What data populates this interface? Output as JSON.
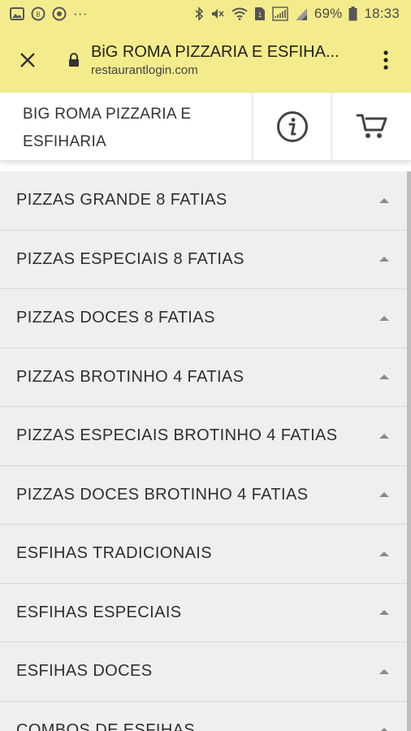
{
  "status_bar": {
    "battery": "69%",
    "time": "18:33",
    "more": "···"
  },
  "browser": {
    "title": "BiG ROMA PIZZARIA E ESFIHA...",
    "host": "restaurantlogin.com"
  },
  "header": {
    "store_line1": "BIG ROMA PIZZARIA E",
    "store_line2": "ESFIHARIA"
  },
  "menu": {
    "categories": [
      "PIZZAS GRANDE 8 FATIAS",
      "PIZZAS ESPECIAIS 8 FATIAS",
      "PIZZAS DOCES 8 FATIAS",
      "PIZZAS BROTINHO 4 FATIAS",
      "PIZZAS ESPECIAIS BROTINHO 4 FATIAS",
      "PIZZAS DOCES BROTINHO 4 FATIAS",
      "ESFIHAS TRADICIONAIS",
      "ESFIHAS ESPECIAIS",
      "ESFIHAS DOCES",
      "COMBOS DE ESFIHAS"
    ]
  },
  "colors": {
    "browser_bar": "#f4ec8c",
    "list_bg": "#efefef",
    "divider": "#d9d9d9"
  },
  "icons": {
    "close": "close-icon",
    "lock": "lock-icon",
    "menu": "more-vert-icon",
    "info": "info-icon",
    "cart": "cart-icon"
  }
}
